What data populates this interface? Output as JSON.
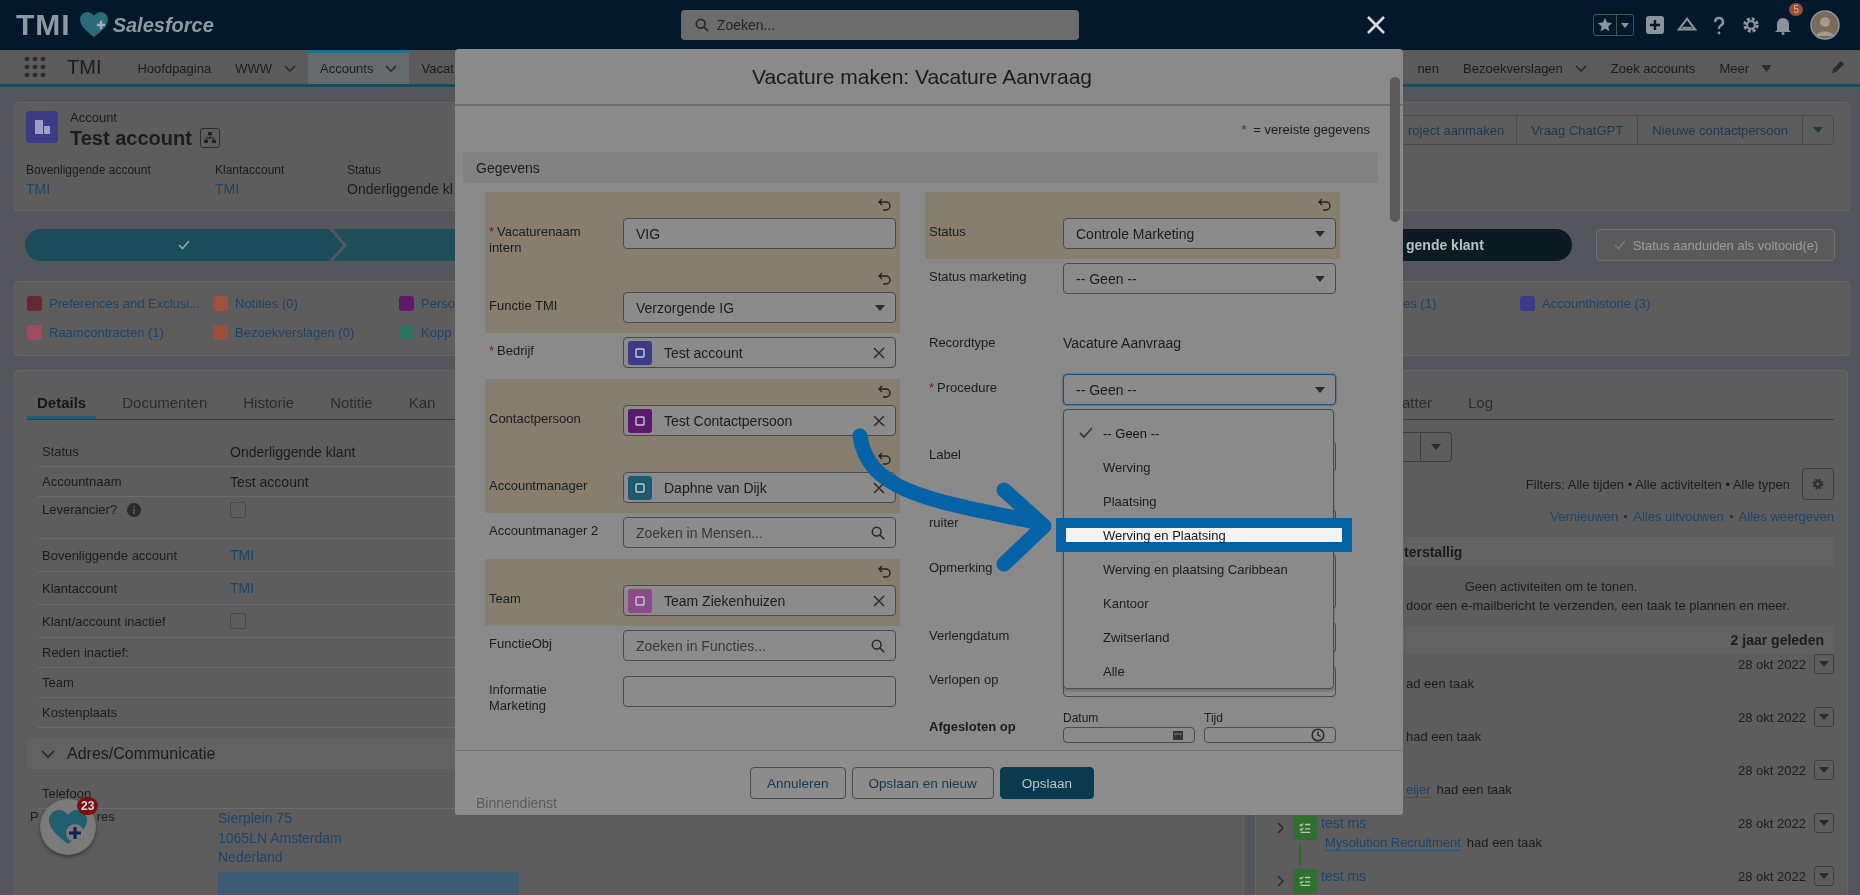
{
  "header": {
    "logo": "TMI",
    "logo_sub": "Salesforce",
    "search": {
      "placeholder": "Zoeken..."
    },
    "notification_count": "5"
  },
  "nav": {
    "app_name": "TMI",
    "items": [
      {
        "label": "Hoofdpagina",
        "menu": false,
        "selected": false
      },
      {
        "label": "WWW",
        "menu": true,
        "selected": false
      },
      {
        "label": "Accounts",
        "menu": true,
        "selected": true
      },
      {
        "label": "Vacat",
        "menu": false,
        "selected": false
      }
    ],
    "right_items": [
      {
        "label": "nen",
        "menu": false
      },
      {
        "label": "Bezoekverslagen",
        "menu": true
      },
      {
        "label": "Zoek accounts",
        "menu": false
      }
    ],
    "more": "Meer"
  },
  "record": {
    "object": "Account",
    "name": "Test account",
    "fields": [
      {
        "label": "Bovenliggende account",
        "value": "TMI",
        "link": true
      },
      {
        "label": "Klantaccount",
        "value": "TMI",
        "link": true
      },
      {
        "label": "Status",
        "value": "Onderliggende kl",
        "link": false
      }
    ],
    "actions": [
      "roject aanmaken",
      "Vraag ChatGPT",
      "Nieuwe contactpersoon"
    ]
  },
  "path": {
    "stages": [
      {
        "kind": "complete"
      },
      {
        "kind": "current"
      }
    ],
    "mark_button": "gende klant",
    "complete_button": {
      "label": "Status aanduiden als voltooid(e)",
      "disabled": true
    }
  },
  "related": {
    "left": [
      {
        "label": "Preferences and Exclusi...",
        "color": "#5c2c2e"
      },
      {
        "label": "Notities (0)",
        "color": "#a0513d"
      },
      {
        "label": "Perso",
        "color": "#5b1a6b"
      },
      {
        "label": "Raamcontracten (1)",
        "color": "#a34a5c"
      },
      {
        "label": "Bezoekverslagen (0)",
        "color": "#a04e3c"
      },
      {
        "label": "Kopp",
        "color": "#2c7561"
      }
    ],
    "right": [
      {
        "label": "es (1)"
      },
      {
        "label": "Accounthistorie (3)",
        "color": "#3b3c85"
      }
    ]
  },
  "details": {
    "tabs": [
      {
        "label": "Details",
        "selected": true
      },
      {
        "label": "Documenten",
        "selected": false
      },
      {
        "label": "Historie",
        "selected": false
      },
      {
        "label": "Notitie",
        "selected": false
      },
      {
        "label": "Kan",
        "selected": false
      }
    ],
    "fields": [
      {
        "label": "Status",
        "kind": "text",
        "value": "Onderliggende klant",
        "info": false
      },
      {
        "label": "Accountnaam",
        "kind": "text",
        "value": "Test account",
        "info": false
      },
      {
        "label": "Leverancier?",
        "kind": "checkbox",
        "checked": false,
        "info": true
      },
      {
        "label": "Bovenliggende account",
        "kind": "link",
        "value": "TMI",
        "info": false
      },
      {
        "label": "Klantaccount",
        "kind": "link",
        "value": "TMI",
        "info": false
      },
      {
        "label": "Klant/account inactief",
        "kind": "checkbox",
        "checked": false,
        "info": false
      },
      {
        "label": "Reden inactief:",
        "kind": "blank",
        "info": false
      },
      {
        "label": "Team",
        "kind": "blank",
        "info": false
      },
      {
        "label": "Kostenplaats",
        "kind": "blank",
        "info": false
      }
    ],
    "section": {
      "title": "Adres/Communicatie",
      "expanded": true
    },
    "section_fields": [
      {
        "label": "Telefoon"
      }
    ],
    "address": {
      "label_start": "P",
      "label_end": "res",
      "lines": [
        "Sierplein 75",
        "1065LN Amsterdam",
        "Nederland"
      ]
    }
  },
  "activity": {
    "tabs": [
      {
        "label": "atter",
        "selected": false
      },
      {
        "label": "Log",
        "selected": false
      }
    ],
    "filters": "Filters: Alle tijden • Alle activiteiten • Alle typen",
    "links": [
      "Vernieuwen",
      "Alles uitvouwen",
      "Alles weergeven"
    ],
    "overdue": "terstallig",
    "empty_title": "Geen activiteiten om te tonen.",
    "empty_hint": "door een e-mailbericht te verzenden, een taak te plannen en meer.",
    "period": "2 jaar geleden",
    "items": [
      {
        "date": "28 okt 2022",
        "text": "ad een taak"
      },
      {
        "date": "28 okt 2022",
        "text": "had een taak"
      },
      {
        "date": "28 okt 2022",
        "actor": "eijer",
        "text": "had een taak"
      },
      {
        "date": "28 okt 2022",
        "subject": "test ms",
        "actor": "Mysolution Recruitment",
        "text": "had een taak"
      },
      {
        "date": "28 okt 2022",
        "subject": "test ms"
      }
    ]
  },
  "modal": {
    "title": "Vacature maken: Vacature Aanvraag",
    "required_mark": "*",
    "required_note": "= vereiste gegevens",
    "section": "Gegevens",
    "left_fields": [
      {
        "label": "Vacaturenaam intern",
        "required": true,
        "changed": true,
        "kind": "text",
        "value": "VIG"
      },
      {
        "label": "Functie TMI",
        "required": false,
        "changed": true,
        "kind": "picklist",
        "value": "Verzorgende IG"
      },
      {
        "label": "Bedrijf",
        "required": true,
        "changed": false,
        "kind": "lookup",
        "value": "Test account",
        "color": "#3b3c85"
      },
      {
        "label": "Contactpersoon",
        "required": false,
        "changed": true,
        "kind": "lookup",
        "value": "Test Contactpersoon",
        "color": "#5b1a6b"
      },
      {
        "label": "Accountmanager",
        "required": false,
        "changed": true,
        "kind": "lookup",
        "value": "Daphne van Dijk",
        "color": "#1d5a70"
      },
      {
        "label": "Accountmanager 2",
        "required": false,
        "changed": false,
        "kind": "search",
        "placeholder": "Zoeken in Mensen..."
      },
      {
        "label": "Team",
        "required": false,
        "changed": true,
        "kind": "lookup",
        "value": "Team Ziekenhuizen",
        "color": "#8a4a8a"
      },
      {
        "label": "FunctieObj",
        "required": false,
        "changed": false,
        "kind": "search",
        "placeholder": "Zoeken in Functies..."
      },
      {
        "label": "Informatie Marketing",
        "required": false,
        "changed": false,
        "kind": "blank"
      }
    ],
    "right_fields": [
      {
        "label": "Status",
        "required": false,
        "changed": true,
        "kind": "picklist",
        "value": "Controle Marketing"
      },
      {
        "label": "Status marketing",
        "required": false,
        "changed": false,
        "kind": "picklist",
        "value": "-- Geen --"
      },
      {
        "label": "Recordtype",
        "required": false,
        "changed": false,
        "kind": "readonly",
        "value": "Vacature Aanvraag"
      },
      {
        "label": "Procedure",
        "required": true,
        "changed": false,
        "kind": "picklist",
        "value": "-- Geen --",
        "open": true,
        "options": [
          {
            "label": "-- Geen --",
            "selected": true,
            "highlighted": false
          },
          {
            "label": "Werving",
            "selected": false,
            "highlighted": false
          },
          {
            "label": "Plaatsing",
            "selected": false,
            "highlighted": false
          },
          {
            "label": "Werving en Plaatsing",
            "selected": false,
            "highlighted": true
          },
          {
            "label": "Werving en plaatsing Caribbean",
            "selected": false,
            "highlighted": false
          },
          {
            "label": "Kantoor",
            "selected": false,
            "highlighted": false
          },
          {
            "label": "Zwitserland",
            "selected": false,
            "highlighted": false
          },
          {
            "label": "Alle",
            "selected": false,
            "highlighted": false
          }
        ]
      },
      {
        "label": "Label",
        "required": false,
        "changed": false,
        "kind": "blank"
      },
      {
        "label": "ruiter",
        "required": false,
        "changed": false,
        "kind": "blank"
      },
      {
        "label": "Opmerking",
        "required": false,
        "changed": false,
        "kind": "textarea"
      },
      {
        "label": "Verlengdatum",
        "required": false,
        "changed": false,
        "kind": "blank"
      },
      {
        "label": "Verlopen op",
        "required": false,
        "changed": false,
        "kind": "blank"
      },
      {
        "label": "Afgesloten op",
        "required": false,
        "changed": false,
        "kind": "datetime",
        "date_label": "Datum",
        "time_label": "Tijd"
      }
    ],
    "footer_hint": "Binnendienst",
    "buttons": [
      {
        "label": "Annuleren",
        "kind": "neutral"
      },
      {
        "label": "Opslaan en nieuw",
        "kind": "neutral"
      },
      {
        "label": "Opslaan",
        "kind": "brand"
      }
    ]
  },
  "helper": {
    "badge": "23"
  }
}
